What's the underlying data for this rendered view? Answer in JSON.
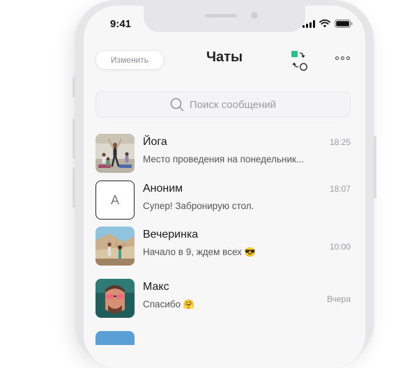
{
  "status_bar": {
    "time": "9:41"
  },
  "header": {
    "edit_label": "Изменить",
    "title": "Чаты"
  },
  "search": {
    "placeholder": "Поиск сообщений"
  },
  "chats": [
    {
      "name": "Йога",
      "message": "Место проведения на понедельник...",
      "time": "18:25",
      "avatar": "photo-yoga"
    },
    {
      "name": "Аноним",
      "message": "Супер! Забронирую стол.",
      "time": "18:07",
      "avatar_letter": "А"
    },
    {
      "name": "Вечеринка",
      "message": "Начало в 9, ждем всех",
      "emoji": "😎",
      "time": "10:00",
      "avatar": "photo-party"
    },
    {
      "name": "Макс",
      "message": "Спасибо",
      "emoji": "🤗",
      "time": "Вчера",
      "avatar": "photo-max"
    }
  ],
  "colors": {
    "accent": "#2bbf8e",
    "text_primary": "#1a1a1a",
    "text_secondary": "#9a9aa0"
  }
}
